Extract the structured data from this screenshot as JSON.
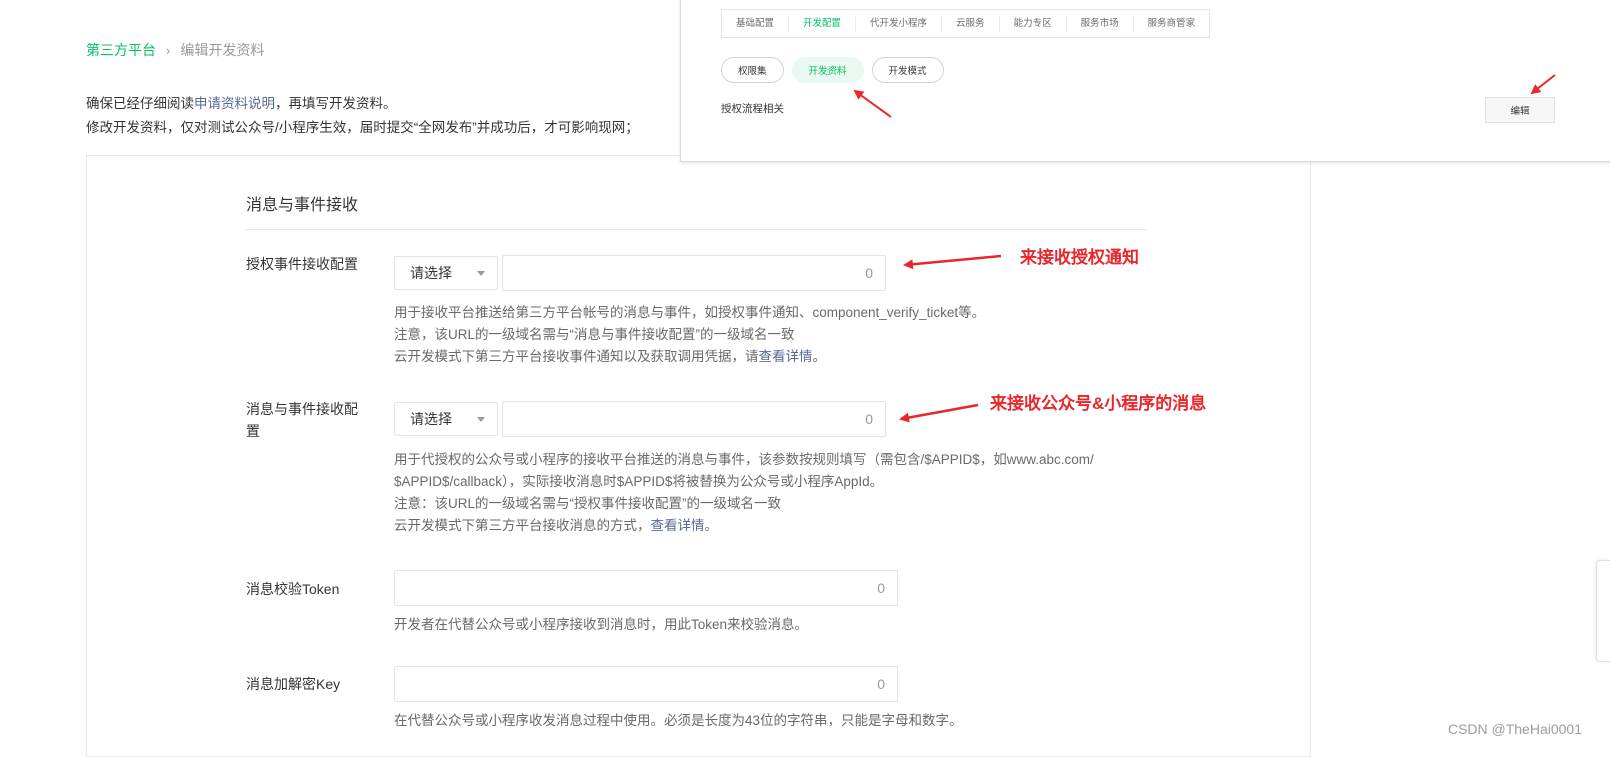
{
  "breadcrumb": {
    "root": "第三方平台",
    "separator": "›",
    "current": "编辑开发资料"
  },
  "notice": {
    "line1_prefix": "确保已经仔细阅读",
    "line1_link": "申请资料说明",
    "line1_suffix": "，再填写开发资料。",
    "line2": "修改开发资料，仅对测试公众号/小程序生效，届时提交“全网发布”并成功后，才可影响现网；"
  },
  "section": {
    "title": "消息与事件接收"
  },
  "fields": {
    "auth_event": {
      "label": "授权事件接收配置",
      "select": "请选择",
      "input_count": "0",
      "help1": "用于接收平台推送给第三方平台帐号的消息与事件，如授权事件通知、component_verify_ticket等。",
      "help2": "注意，该URL的一级域名需与“消息与事件接收配置”的一级域名一致",
      "help3_prefix": "云开发模式下第三方平台接收事件通知以及获取调用凭据，请",
      "help3_link": "查看详情",
      "help3_suffix": "。"
    },
    "msg_event": {
      "label": "消息与事件接收配置",
      "select": "请选择",
      "input_count": "0",
      "help1": "用于代授权的公众号或小程序的接收平台推送的消息与事件，该参数按规则填写（需包含/$APPID$，如www.abc.com/",
      "help2": "$APPID$/callback），实际接收消息时$APPID$将被替换为公众号或小程序AppId。",
      "help3": "注意：该URL的一级域名需与“授权事件接收配置”的一级域名一致",
      "help4_prefix": "云开发模式下第三方平台接收消息的方式，",
      "help4_link": "查看详情",
      "help4_suffix": "。"
    },
    "token": {
      "label": "消息校验Token",
      "input_count": "0",
      "help": "开发者在代替公众号或小程序接收到消息时，用此Token来校验消息。"
    },
    "aes_key": {
      "label": "消息加解密Key",
      "input_count": "0",
      "help": "在代替公众号或小程序收发消息过程中使用。必须是长度为43位的字符串，只能是字母和数字。"
    }
  },
  "overlay": {
    "tabs": [
      "基础配置",
      "开发配置",
      "代开发小程序",
      "云服务",
      "能力专区",
      "服务市场",
      "服务商管家"
    ],
    "active_tab_index": 1,
    "pills": [
      "权限集",
      "开发资料",
      "开发模式"
    ],
    "active_pill_index": 1,
    "label": "授权流程相关",
    "edit_button": "编辑"
  },
  "annotations": {
    "auth": "来接收授权通知",
    "msg": "来接收公众号&小程序的消息",
    "color": "#e8262c"
  },
  "watermark": "CSDN @TheHai0001",
  "colors": {
    "accent": "#07c160",
    "link": "#576b95",
    "annotation": "#e8262c"
  }
}
